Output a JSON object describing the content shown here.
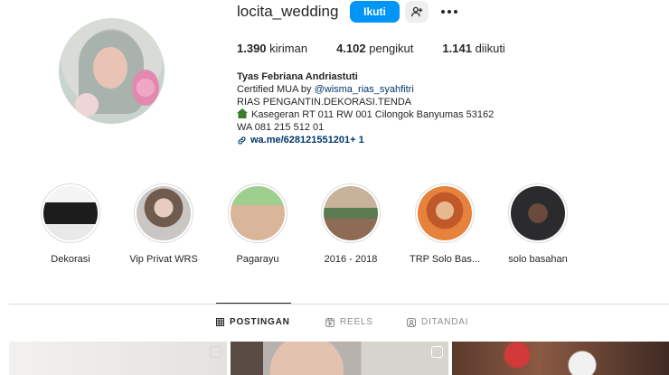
{
  "profile": {
    "username": "locita_wedding",
    "follow_label": "Ikuti",
    "stats": [
      {
        "value": "1.390",
        "label": "kiriman"
      },
      {
        "value": "4.102",
        "label": "pengikut"
      },
      {
        "value": "1.141",
        "label": "diikuti"
      }
    ],
    "bio": {
      "name": "Tyas Febriana Andriastuti",
      "line1_prefix": "Certified MUA by ",
      "line1_mention": "@wisma_rias_syahfitri",
      "line2": "RIAS PENGANTIN.DEKORASI.TENDA",
      "line3": "Kasegeran RT 011 RW 001 Cilongok Banyumas 53162",
      "line4": "WA 081 215 512 01",
      "link": "wa.me/628121551201",
      "link_more": " + 1"
    }
  },
  "highlights": [
    {
      "label": "Dekorasi"
    },
    {
      "label": "Vip Privat WRS"
    },
    {
      "label": "Pagarayu"
    },
    {
      "label": "2016 - 2018"
    },
    {
      "label": "TRP Solo Bas..."
    },
    {
      "label": "solo basahan"
    }
  ],
  "tabs": [
    {
      "label": "POSTINGAN",
      "icon": "grid-icon",
      "active": true
    },
    {
      "label": "REELS",
      "icon": "reels-icon",
      "active": false
    },
    {
      "label": "DITANDAI",
      "icon": "tagged-icon",
      "active": false
    }
  ],
  "colors": {
    "accent": "#0095f6",
    "link": "#00376b",
    "text": "#262626",
    "muted": "#8e8e8e"
  }
}
